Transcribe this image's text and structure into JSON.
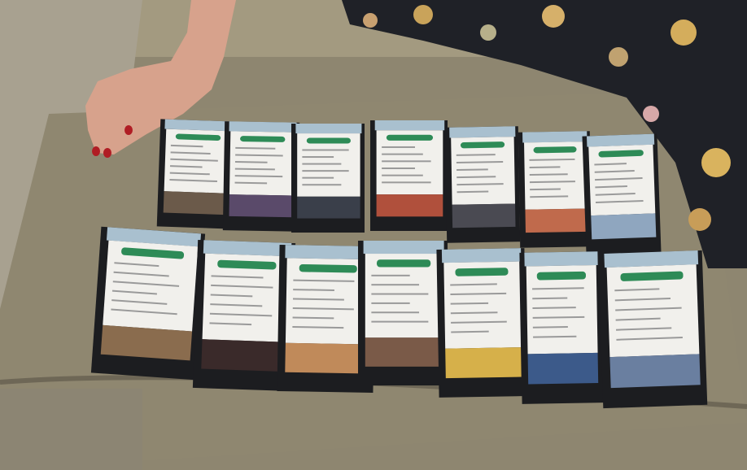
{
  "scene": {
    "description_colors": {
      "sofa": "#9c9277",
      "sofa_shadow": "#6f6754",
      "card_frame": "#1c1d20",
      "card_screen": "#f1f0ec",
      "card_header": "#a9c0cf",
      "accent_button": "#2e8b57",
      "skin": "#d9a48e",
      "nail": "#b01d24",
      "dress": "#1d1e24"
    }
  },
  "cards": {
    "top_row": [
      {
        "button": "",
        "img": "#6b5a4a"
      },
      {
        "button": "",
        "img": "#5a4a6a"
      },
      {
        "button": "",
        "img": "#3a3f4a"
      },
      {
        "button": "",
        "img": "#b0503c"
      },
      {
        "button": "",
        "img": "#4a4a52"
      },
      {
        "button": "",
        "img": "#c06a4c"
      },
      {
        "button": "",
        "img": "#8fa6bf"
      }
    ],
    "bottom_row": [
      {
        "button": "",
        "img": "#8a6c4e"
      },
      {
        "button": "",
        "img": "#3a2a2a"
      },
      {
        "button": "",
        "img": "#c08a5a"
      },
      {
        "button": "",
        "img": "#7a5a48"
      },
      {
        "button": "",
        "img": "#d6b04a"
      },
      {
        "button": "",
        "img": "#3c5a8a"
      },
      {
        "button": "",
        "img": "#6a7fa0"
      }
    ]
  }
}
